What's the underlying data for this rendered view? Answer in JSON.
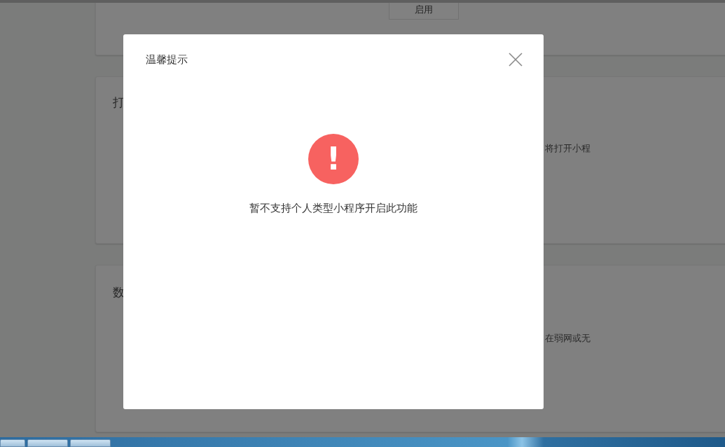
{
  "background": {
    "cards": [
      {
        "kind": "button",
        "button": "启用"
      },
      {
        "kind": "setting",
        "title": "打",
        "description": "将打开小程"
      },
      {
        "kind": "setting",
        "title": "数",
        "description": "在弱网或无"
      }
    ]
  },
  "dialog": {
    "title": "温馨提示",
    "icon": "!",
    "message": "暂不支持个人类型小程序开启此功能"
  }
}
